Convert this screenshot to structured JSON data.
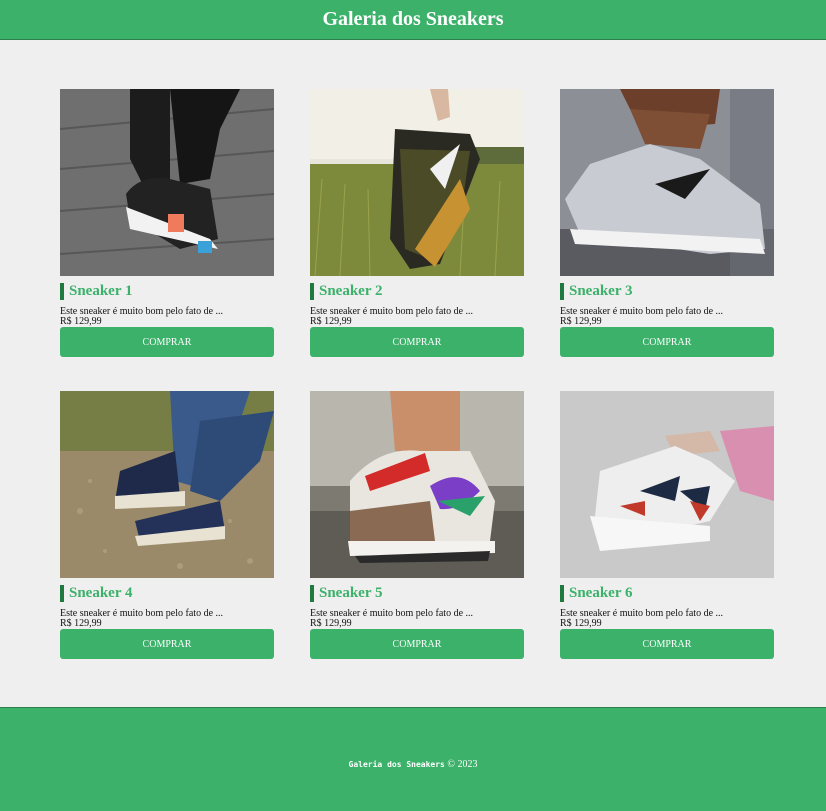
{
  "header": {
    "title": "Galeria dos Sneakers"
  },
  "colors": {
    "accent": "#3cb16a",
    "accent_dark": "#1f7a3f",
    "background": "#efefef"
  },
  "products": [
    {
      "title": "Sneaker 1",
      "description": "Este sneaker é muito bom pelo fato de ...",
      "price": "R$ 129,99",
      "button": "COMPRAR",
      "image": "black-white-sneaker-wooden-floor"
    },
    {
      "title": "Sneaker 2",
      "description": "Este sneaker é muito bom pelo fato de ...",
      "price": "R$ 129,99",
      "button": "COMPRAR",
      "image": "hand-holding-sneakers-field"
    },
    {
      "title": "Sneaker 3",
      "description": "Este sneaker é muito bom pelo fato de ...",
      "price": "R$ 129,99",
      "button": "COMPRAR",
      "image": "grey-knit-sneaker-walking"
    },
    {
      "title": "Sneaker 4",
      "description": "Este sneaker é muito bom pelo fato de ...",
      "price": "R$ 129,99",
      "button": "COMPRAR",
      "image": "blue-canvas-high-tops-jeans"
    },
    {
      "title": "Sneaker 5",
      "description": "Este sneaker é muito bom pelo fato de ...",
      "price": "R$ 129,99",
      "button": "COMPRAR",
      "image": "colorful-low-top-sneaker"
    },
    {
      "title": "Sneaker 6",
      "description": "Este sneaker é muito bom pelo fato de ...",
      "price": "R$ 129,99",
      "button": "COMPRAR",
      "image": "hand-holding-white-runners"
    }
  ],
  "footer": {
    "brand": "Galeria dos Sneakers",
    "copyright": "© 2023"
  }
}
